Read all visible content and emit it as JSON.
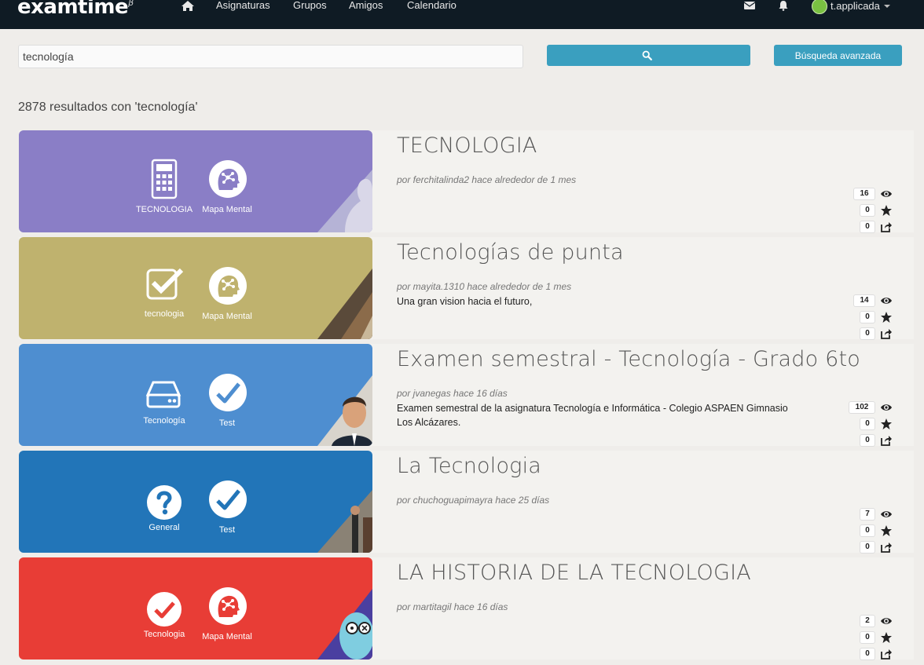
{
  "navbar": {
    "logo": "examtime",
    "logo_sup": "β",
    "links": [
      "Asignaturas",
      "Grupos",
      "Amigos",
      "Calendario"
    ],
    "user_name": "t.applicada"
  },
  "search": {
    "value": "tecnología",
    "advanced_label": "Búsqueda avanzada"
  },
  "results_count": "2878 resultados con 'tecnología'",
  "colors": {
    "navbar": "#0f1b24",
    "button": "#3a9fbf",
    "item1": "#8a7ec6",
    "item2": "#bfb26e",
    "item3": "#4e8ed0",
    "item4": "#2275b8",
    "item5": "#e83d36"
  },
  "results": [
    {
      "title": "TECNOLOGIA",
      "meta": "por ferchitalinda2 hace alrededor de 1 mes",
      "desc": "",
      "subject_label": "TECNOLOGIA",
      "subject_icon": "calculator-icon",
      "type_label": "Mapa Mental",
      "type_icon": "mind-map-icon",
      "views": "16",
      "favs": "0",
      "shares": "0"
    },
    {
      "title": "Tecnologías de punta",
      "meta": "por mayita.1310 hace alrededor de 1 mes",
      "desc": "Una gran vision hacia el futuro,",
      "subject_label": "tecnologia",
      "subject_icon": "checkbox-icon",
      "type_label": "Mapa Mental",
      "type_icon": "mind-map-icon",
      "views": "14",
      "favs": "0",
      "shares": "0"
    },
    {
      "title": "Examen semestral - Tecnología - Grado 6to",
      "meta": "por jvanegas hace 16 días",
      "desc": "Examen semestral de la asignatura Tecnología e Informática - Colegio ASPAEN Gimnasio Los Alcázares.",
      "subject_label": "Tecnología",
      "subject_icon": "hard-drive-icon",
      "type_label": "Test",
      "type_icon": "check-circle-icon",
      "views": "102",
      "favs": "0",
      "shares": "0"
    },
    {
      "title": "La Tecnologia",
      "meta": "por chuchoguapimayra hace 25 días",
      "desc": "",
      "subject_label": "General",
      "subject_icon": "question-icon",
      "type_label": "Test",
      "type_icon": "check-circle-icon",
      "views": "7",
      "favs": "0",
      "shares": "0"
    },
    {
      "title": "LA HISTORIA DE LA TECNOLOGIA",
      "meta": "por martitagil hace 16 días",
      "desc": "",
      "subject_label": "Tecnologia",
      "subject_icon": "check-circle-icon",
      "type_label": "Mapa Mental",
      "type_icon": "mind-map-icon",
      "views": "2",
      "favs": "0",
      "shares": "0"
    }
  ]
}
